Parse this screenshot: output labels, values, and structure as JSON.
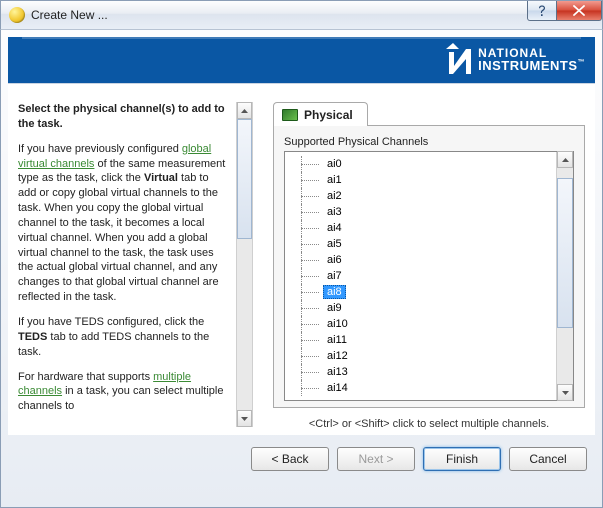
{
  "window_title": "Create New ...",
  "brand": {
    "line1": "NATIONAL",
    "line2": "INSTRUMENTS",
    "tm": "™"
  },
  "help": {
    "heading": "Select the physical channel(s) to add to the task.",
    "p1_a": "If you have previously configured ",
    "p1_link": "global virtual channels",
    "p1_b": " of the same measurement type as the task, click the ",
    "p1_bold1": "Virtual",
    "p1_c": " tab to add or copy global virtual channels to the task. When you copy the global virtual channel to the task, it becomes a local virtual channel. When you add a global virtual channel to the task, the task uses the actual global virtual channel, and any changes to that global virtual channel are reflected in the task.",
    "p2_a": "If you have TEDS configured, click the ",
    "p2_bold": "TEDS",
    "p2_b": " tab to add TEDS channels to the task.",
    "p3_a": "For hardware that supports ",
    "p3_link": "multiple channels",
    "p3_b": " in a task, you can select multiple channels to"
  },
  "tab_label": "Physical",
  "supported_label": "Supported Physical Channels",
  "selected_channel": "ai8",
  "channels": [
    "ai0",
    "ai1",
    "ai2",
    "ai3",
    "ai4",
    "ai5",
    "ai6",
    "ai7",
    "ai8",
    "ai9",
    "ai10",
    "ai11",
    "ai12",
    "ai13",
    "ai14"
  ],
  "hint": "<Ctrl> or <Shift> click to select multiple channels.",
  "buttons": {
    "back": "< Back",
    "next": "Next >",
    "finish": "Finish",
    "cancel": "Cancel"
  }
}
